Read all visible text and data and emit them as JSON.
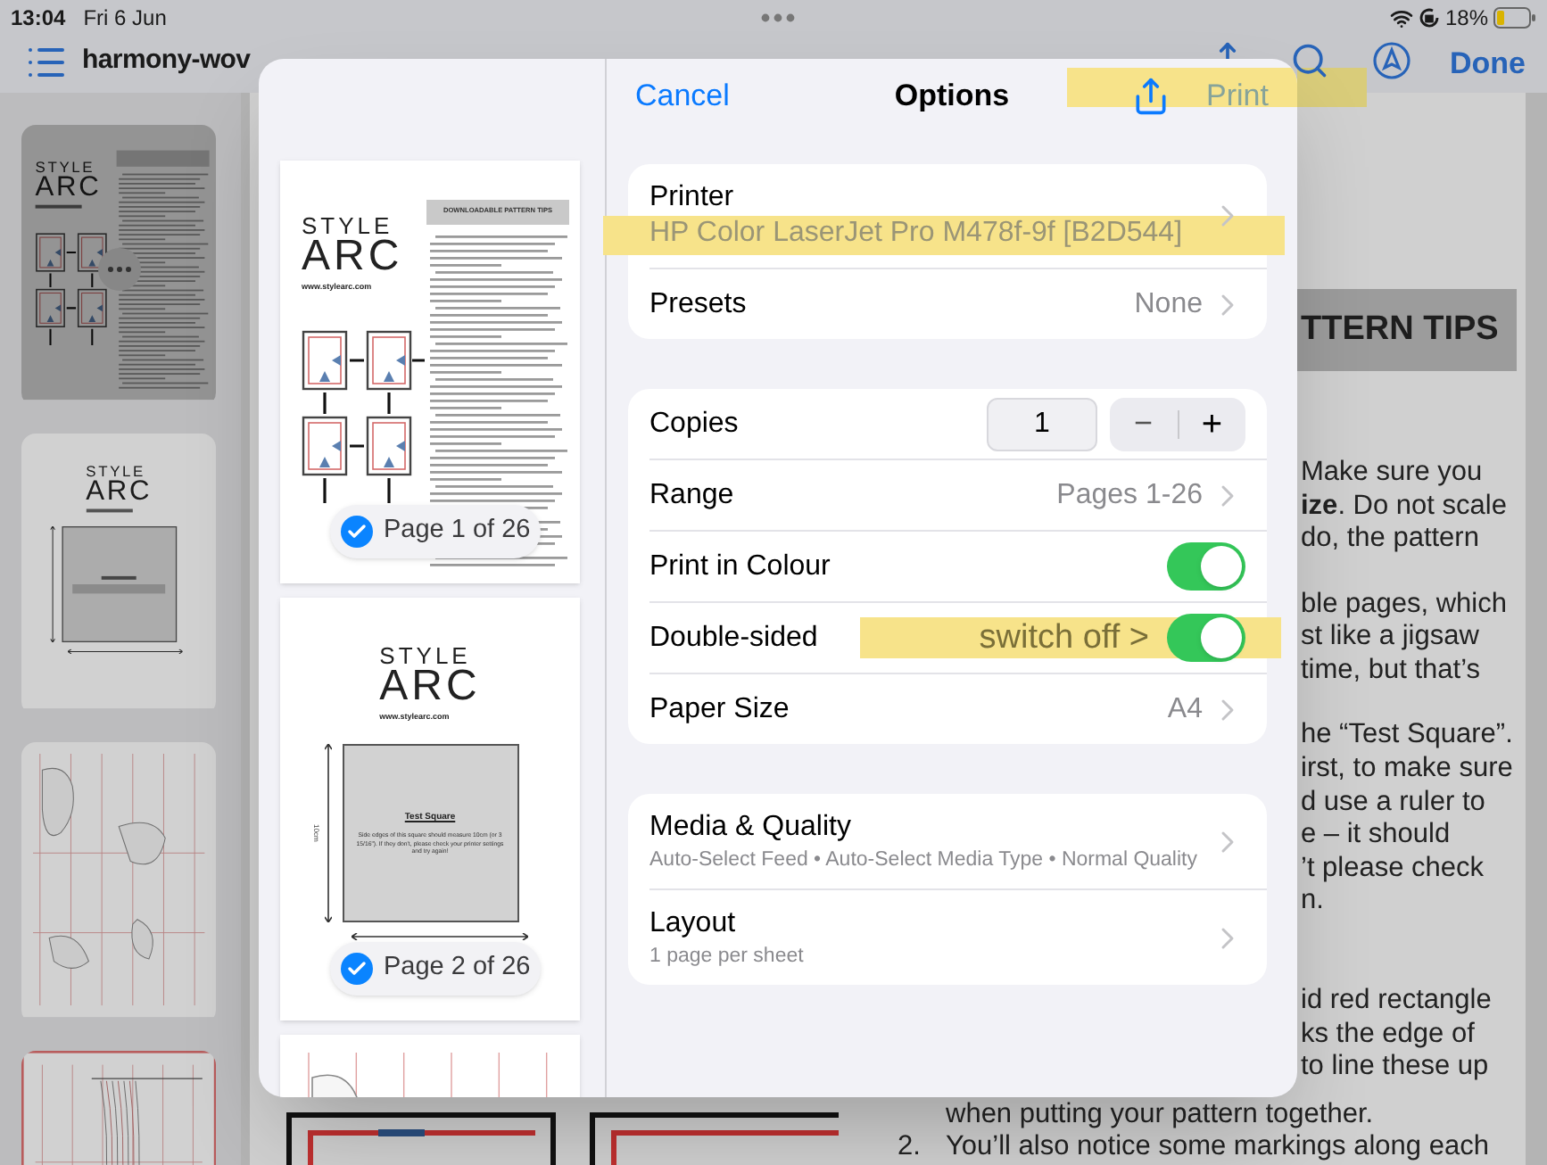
{
  "status_bar": {
    "time": "13:04",
    "date": "Fri 6 Jun",
    "battery": "18%"
  },
  "toolbar": {
    "title": "harmony-wov",
    "done": "Done"
  },
  "thumbnails": [
    {
      "kind": "tips",
      "selected": true,
      "brand": "STYLE",
      "brand_large": "ARC"
    },
    {
      "kind": "square",
      "selected": false,
      "brand": "STYLE",
      "brand_large": "ARC"
    },
    {
      "kind": "pattern",
      "selected": false
    },
    {
      "kind": "ruler",
      "selected": false
    }
  ],
  "document": {
    "header": "TTERN TIPS",
    "paragraphs": [
      {
        "lines": [
          {
            "kind": "cut",
            "text": "Make sure you"
          },
          {
            "kind": "cut",
            "text": "**ize**. Do not scale"
          },
          {
            "kind": "cut",
            "text": "do, the pattern"
          }
        ]
      },
      {
        "lines": [
          {
            "kind": "cut",
            "text": "ble pages, which"
          },
          {
            "kind": "cut",
            "text": "st like a jigsaw"
          },
          {
            "kind": "cut",
            "text": "time, but that’s"
          }
        ]
      },
      {
        "lines": [
          {
            "kind": "cut",
            "text": "he “Test Square”."
          },
          {
            "kind": "cut",
            "text": "irst, to make sure"
          },
          {
            "kind": "cut",
            "text": "d use a ruler to"
          },
          {
            "kind": "cut",
            "text": "e – it should"
          },
          {
            "kind": "cut",
            "text": "’t please check"
          },
          {
            "kind": "cut",
            "text": "n."
          }
        ]
      },
      {
        "lines": [
          {
            "kind": "cut",
            "text": "id red rectangle"
          },
          {
            "kind": "cut",
            "text": "ks the edge of"
          },
          {
            "kind": "cut",
            "text": "to line these up"
          },
          {
            "kind": "full",
            "text": "when putting your pattern together."
          },
          {
            "kind": "item",
            "number": "2.",
            "text": "You’ll also notice some markings along each"
          }
        ]
      }
    ]
  },
  "dialog": {
    "cancel": "Cancel",
    "title": "Options",
    "print": "Print",
    "previews": [
      {
        "kind": "tips",
        "checked": true,
        "label": "Page 1 of 26",
        "brand": "STYLE",
        "brand_large": "ARC",
        "url": "www.stylearc.com",
        "heading": "DOWNLOADABLE PATTERN TIPS"
      },
      {
        "kind": "square",
        "checked": true,
        "label": "Page 2 of 26",
        "brand": "STYLE",
        "brand_large": "ARC",
        "url": "www.stylearc.com",
        "heading": "Test Square",
        "note": "Side edges of this square should measure 10cm (or 3 15/16\"). If they don't, please check your printer settings and try again!",
        "measure": "10cm"
      },
      {
        "kind": "pattern"
      }
    ],
    "groups": [
      {
        "rows": [
          {
            "kind": "selector",
            "label": "Printer",
            "value": "HP Color LaserJet Pro M478f-9f [B2D544]"
          },
          {
            "kind": "value",
            "label": "Presets",
            "value": "None"
          }
        ]
      },
      {
        "rows": [
          {
            "kind": "stepper",
            "label": "Copies",
            "value": "1",
            "minus": "−",
            "plus": "+"
          },
          {
            "kind": "value",
            "label": "Range",
            "value": "Pages 1-26"
          },
          {
            "kind": "toggle",
            "label": "Print in Colour",
            "on": true
          },
          {
            "kind": "toggle",
            "label": "Double-sided",
            "on": true,
            "note": "switch off >"
          },
          {
            "kind": "value",
            "label": "Paper Size",
            "value": "A4"
          }
        ]
      },
      {
        "rows": [
          {
            "kind": "detail",
            "label": "Media & Quality",
            "value": "Auto-Select Feed • Auto-Select Media Type • Normal Quality"
          },
          {
            "kind": "detail",
            "label": "Layout",
            "value": "1 page per sheet"
          }
        ]
      }
    ]
  }
}
